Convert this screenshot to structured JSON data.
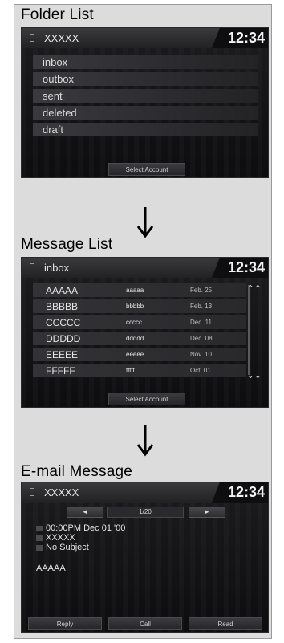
{
  "folder_section": {
    "title": "Folder List",
    "status_title": "XXXXX",
    "time": "12:34",
    "folders": [
      "inbox",
      "outbox",
      "sent",
      "deleted",
      "draft"
    ],
    "softkey": "Select Account"
  },
  "message_section": {
    "title": "Message List",
    "status_title": "inbox",
    "time": "12:34",
    "messages": [
      {
        "sender": "AAAAA",
        "subject": "aaaaa",
        "date": "Feb. 25"
      },
      {
        "sender": "BBBBB",
        "subject": "bbbbb",
        "date": "Feb. 13"
      },
      {
        "sender": "CCCCC",
        "subject": "ccccc",
        "date": "Dec. 11"
      },
      {
        "sender": "DDDDD",
        "subject": "ddddd",
        "date": "Dec. 08"
      },
      {
        "sender": "EEEEE",
        "subject": "eeeee",
        "date": "Nov. 10"
      },
      {
        "sender": "FFFFF",
        "subject": "fffff",
        "date": "Oct. 01"
      }
    ],
    "softkey": "Select Account"
  },
  "email_section": {
    "title": "E-mail Message",
    "status_title": "XXXXX",
    "time": "12:34",
    "prev_label": "◄",
    "next_label": "►",
    "page_indicator": "1/20",
    "datetime": "00:00PM Dec 01 '00",
    "from": "XXXXX",
    "subject": "No Subject",
    "body": "AAAAA",
    "softkeys": [
      "Reply",
      "Call",
      "Read"
    ]
  }
}
